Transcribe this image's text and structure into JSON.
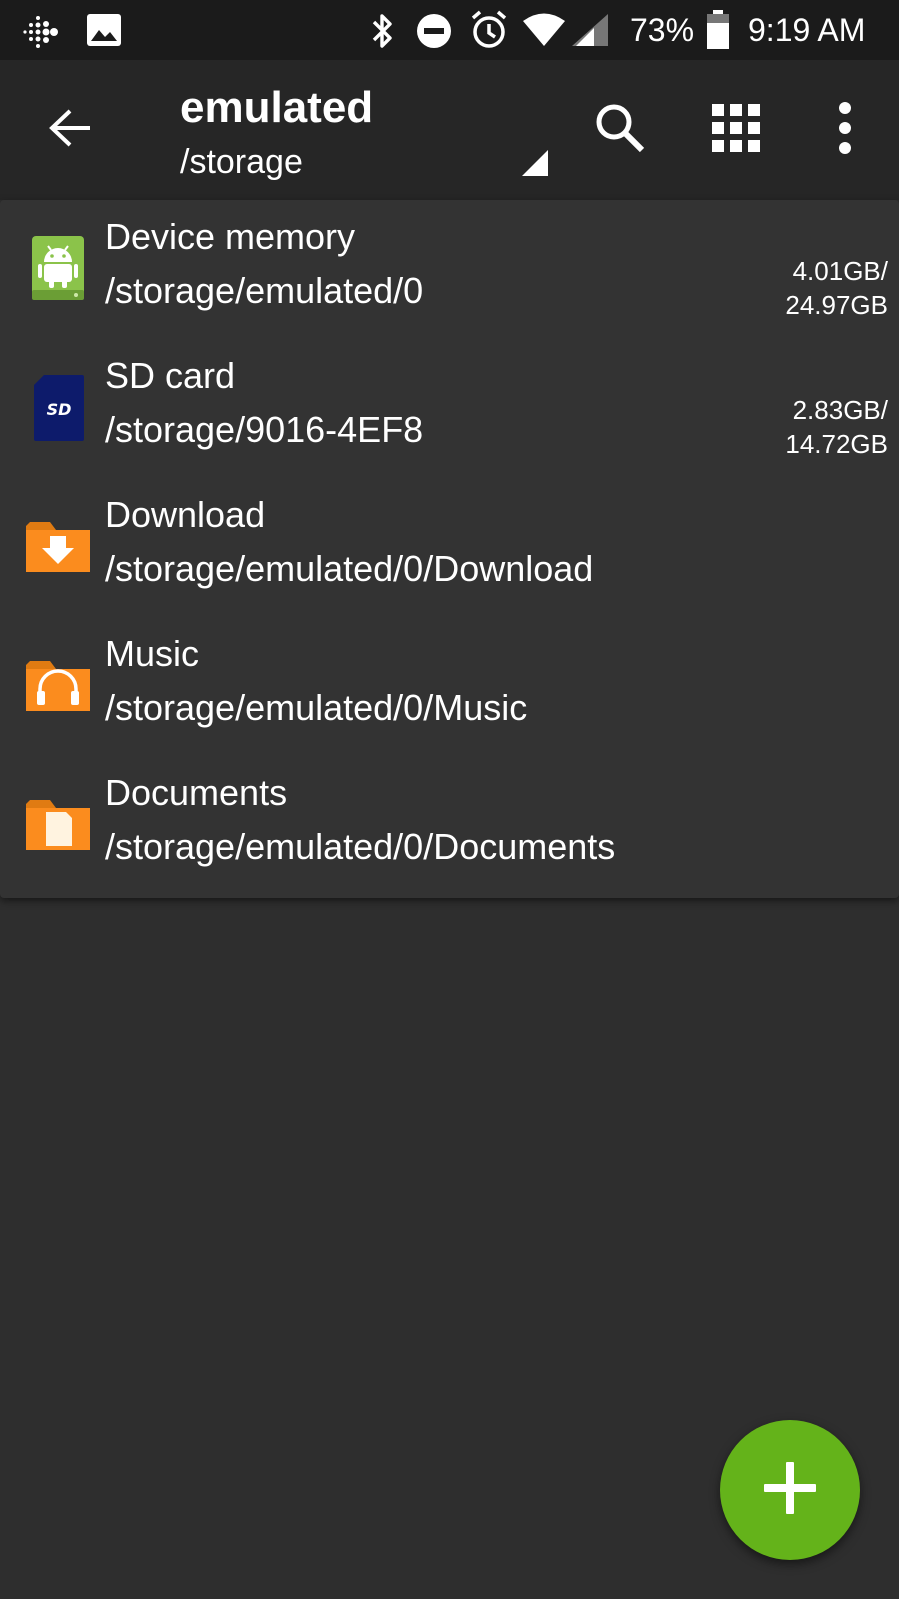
{
  "status_bar": {
    "battery_percent": "73%",
    "time": "9:19 AM",
    "left_icons": [
      "fitbit-icon",
      "image-icon"
    ],
    "right_icons": [
      "bluetooth-icon",
      "do-not-disturb-icon",
      "alarm-icon",
      "wifi-icon",
      "cell-signal-icon",
      "battery-icon"
    ]
  },
  "app_bar": {
    "title": "emulated",
    "subtitle": "/storage",
    "icons": [
      "back-arrow-icon",
      "search-icon",
      "grid-view-icon",
      "more-vert-icon"
    ]
  },
  "items": [
    {
      "title": "Device memory",
      "path": "/storage/emulated/0",
      "used": "4.01GB/",
      "total": "24.97GB",
      "icon": "android-storage-icon"
    },
    {
      "title": "SD card",
      "path": "/storage/9016-4EF8",
      "used": "2.83GB/",
      "total": "14.72GB",
      "icon": "sd-card-icon"
    },
    {
      "title": "Download",
      "path": "/storage/emulated/0/Download",
      "icon": "download-folder-icon"
    },
    {
      "title": "Music",
      "path": "/storage/emulated/0/Music",
      "icon": "music-folder-icon"
    },
    {
      "title": "Documents",
      "path": "/storage/emulated/0/Documents",
      "icon": "documents-folder-icon"
    }
  ],
  "fab": {
    "icon": "plus-icon",
    "color": "#64b31a"
  },
  "colors": {
    "background": "#2e2e2e",
    "app_bar": "#262626",
    "status_bar": "#1b1b1b",
    "folder_orange": "#fb8c1e",
    "android_green": "#8bc34a",
    "sd_blue": "#0d1b6b"
  }
}
